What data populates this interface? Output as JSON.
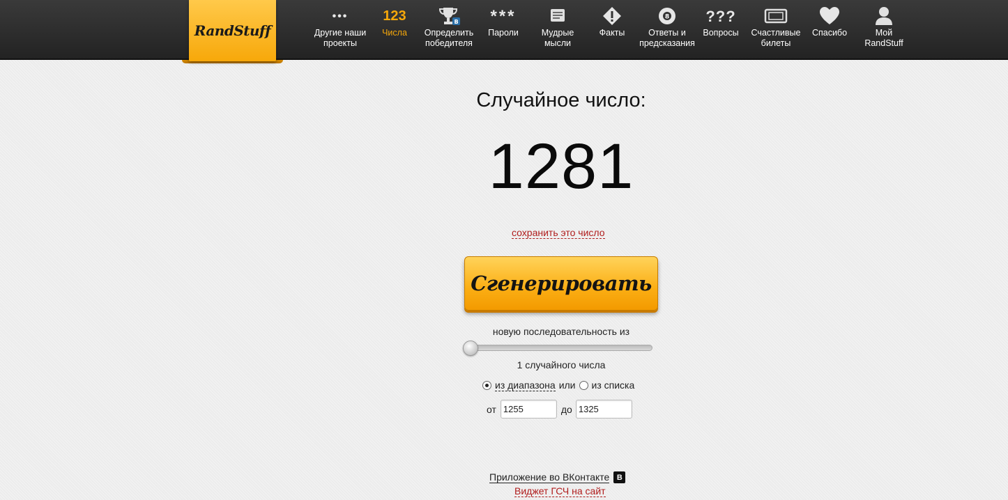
{
  "brand": {
    "logo_text": "RandStuff"
  },
  "nav": {
    "items": [
      {
        "label": "Другие наши\nпроекты",
        "icon": "more-dots-icon",
        "icon_glyph": "•••"
      },
      {
        "label": "Числа",
        "icon": "numbers-icon",
        "icon_glyph": "123",
        "active": true
      },
      {
        "label": "Определить\nпобедителя",
        "icon": "trophy-icon",
        "icon_glyph": "🏆"
      },
      {
        "label": "Пароли",
        "icon": "password-icon",
        "icon_glyph": "***"
      },
      {
        "label": "Мудрые\nмысли",
        "icon": "scroll-icon",
        "icon_glyph": "📜"
      },
      {
        "label": "Факты",
        "icon": "warning-icon",
        "icon_glyph": "◆"
      },
      {
        "label": "Ответы и\nпредсказания",
        "icon": "eight-ball-icon",
        "icon_glyph": "●"
      },
      {
        "label": "Вопросы",
        "icon": "question-marks-icon",
        "icon_glyph": "???"
      },
      {
        "label": "Счастливые\nбилеты",
        "icon": "ticket-icon",
        "icon_glyph": "▭"
      },
      {
        "label": "Спасибо",
        "icon": "heart-icon",
        "icon_glyph": "♥"
      },
      {
        "label": "Мой\nRandStuff",
        "icon": "user-icon",
        "icon_glyph": "👤"
      }
    ]
  },
  "main": {
    "heading": "Случайное число:",
    "number": "1281",
    "save_link": "сохранить это число",
    "generate_button": "Сгенерировать",
    "sequence_label": "новую последовательность из",
    "slider_level": 0,
    "count_label": "1 случайного числа",
    "mode": {
      "range_label": "из диапазона",
      "or_label": "или",
      "list_label": "из списка",
      "selected": "range"
    },
    "range": {
      "from_label": "от",
      "from_value": "1255",
      "to_label": "до",
      "to_value": "1325"
    }
  },
  "footer": {
    "vk_app_link": "Приложение во ВКонтакте",
    "vk_badge": "В",
    "widget_link": "Виджет ГСЧ на сайт"
  },
  "colors": {
    "accent": "#f7a80a",
    "link_red": "#b01c1c",
    "nav_bg": "#2d2d2d"
  }
}
